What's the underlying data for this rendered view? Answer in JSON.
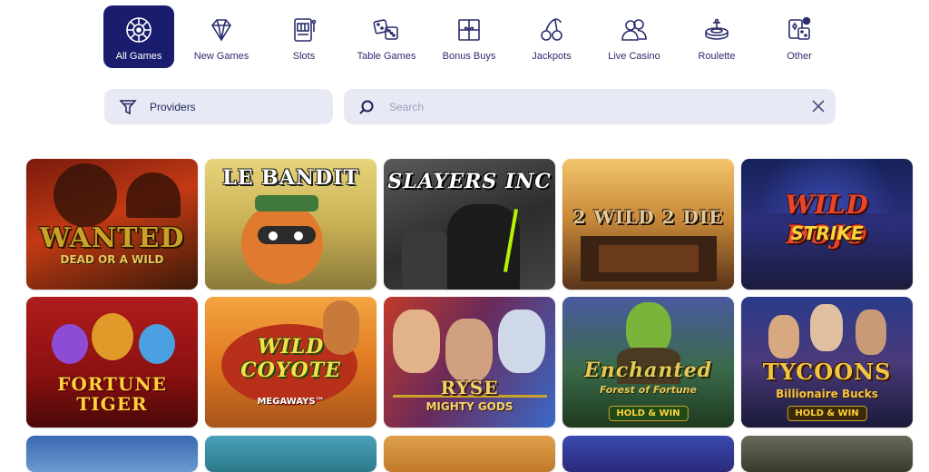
{
  "nav": {
    "items": [
      {
        "label": "All Games",
        "icon": "roulette-wheel-icon",
        "active": true
      },
      {
        "label": "New Games",
        "icon": "diamond-icon",
        "active": false
      },
      {
        "label": "Slots",
        "icon": "slot-machine-icon",
        "active": false
      },
      {
        "label": "Table Games",
        "icon": "dice-icon",
        "active": false
      },
      {
        "label": "Bonus Buys",
        "icon": "gift-box-icon",
        "active": false
      },
      {
        "label": "Jackpots",
        "icon": "cherries-icon",
        "active": false
      },
      {
        "label": "Live Casino",
        "icon": "people-icon",
        "active": false
      },
      {
        "label": "Roulette",
        "icon": "roulette-table-icon",
        "active": false
      },
      {
        "label": "Other",
        "icon": "cards-dice-icon",
        "active": false
      }
    ]
  },
  "filters": {
    "providers_label": "Providers",
    "search_placeholder": "Search"
  },
  "games": {
    "row1": [
      {
        "title": "WANTED",
        "subtitle": "DEAD OR A WILD"
      },
      {
        "title": "LE BANDIT",
        "subtitle": ""
      },
      {
        "title": "SLAYERS INC",
        "subtitle": ""
      },
      {
        "title": "2 WILD 2 DIE",
        "subtitle": ""
      },
      {
        "title": "WILD DOJO",
        "subtitle": "STRIKE"
      }
    ],
    "row2": [
      {
        "title": "FORTUNE",
        "subtitle": "TIGER",
        "badge": ""
      },
      {
        "title": "WILD COYOTE",
        "subtitle": "MEGAWAYS™",
        "badge": ""
      },
      {
        "title": "RYSE",
        "subtitle": "MIGHTY GODS",
        "badge": ""
      },
      {
        "title": "Enchanted",
        "subtitle": "Forest of Fortune",
        "badge": "HOLD & WIN"
      },
      {
        "title": "TYCOONS",
        "subtitle": "Billionaire Bucks",
        "badge": "HOLD & WIN"
      }
    ]
  },
  "colors": {
    "accent": "#1a1d6e",
    "field_bg": "#e7eaf5",
    "text": "#1f2459"
  }
}
